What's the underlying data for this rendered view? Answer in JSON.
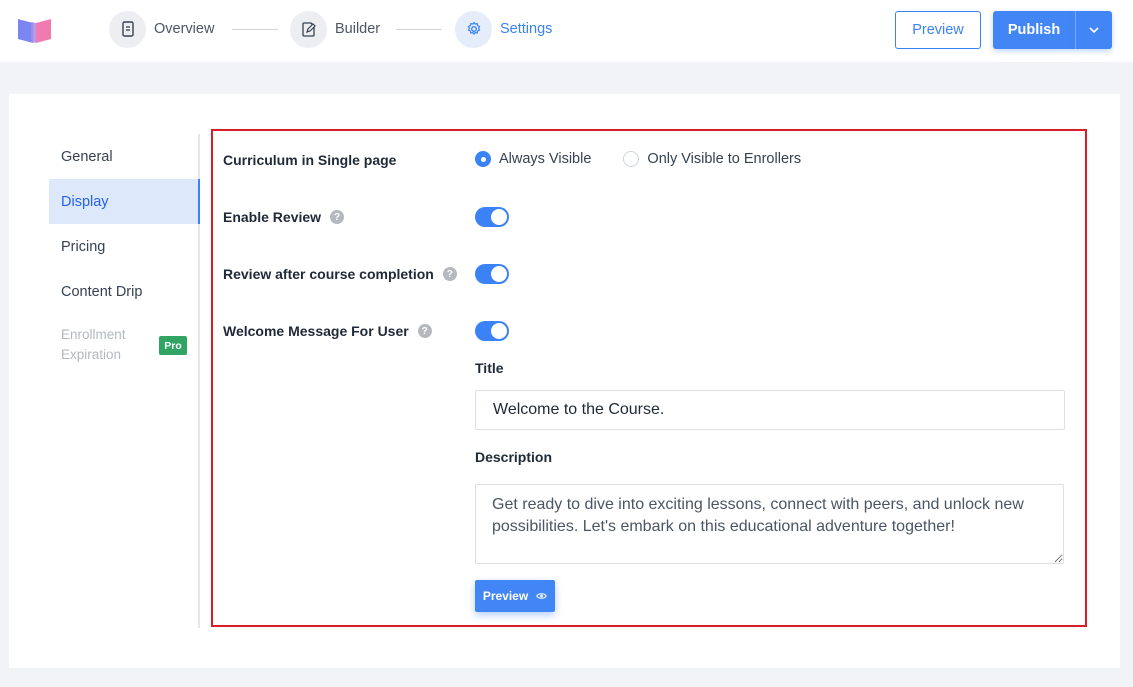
{
  "header": {
    "steps": [
      {
        "label": "Overview",
        "icon": "document-icon"
      },
      {
        "label": "Builder",
        "icon": "edit-icon"
      },
      {
        "label": "Settings",
        "icon": "gear-icon"
      }
    ],
    "active_step": "Settings",
    "preview_label": "Preview",
    "publish_label": "Publish"
  },
  "sidebar": {
    "items": [
      {
        "label": "General"
      },
      {
        "label": "Display"
      },
      {
        "label": "Pricing"
      },
      {
        "label": "Content Drip"
      },
      {
        "label": "Enrollment Expiration"
      }
    ],
    "active_item": "Display",
    "pro_badge": "Pro"
  },
  "settings": {
    "curriculum": {
      "label": "Curriculum in Single page",
      "options": [
        "Always Visible",
        "Only Visible to Enrollers"
      ],
      "selected": "Always Visible"
    },
    "enable_review": {
      "label": "Enable Review",
      "enabled": true
    },
    "review_after_completion": {
      "label": "Review after course completion",
      "enabled": true
    },
    "welcome_message": {
      "label": "Welcome Message For User",
      "enabled": true,
      "title_label": "Title",
      "title_value": "Welcome to the Course.",
      "description_label": "Description",
      "description_value": "Get ready to dive into exciting lessons, connect with peers, and unlock new possibilities. Let's embark on this educational adventure together!",
      "preview_label": "Preview"
    }
  },
  "colors": {
    "accent": "#4285f4",
    "highlight_border": "#d61f26",
    "pro_badge": "#2fa463"
  }
}
